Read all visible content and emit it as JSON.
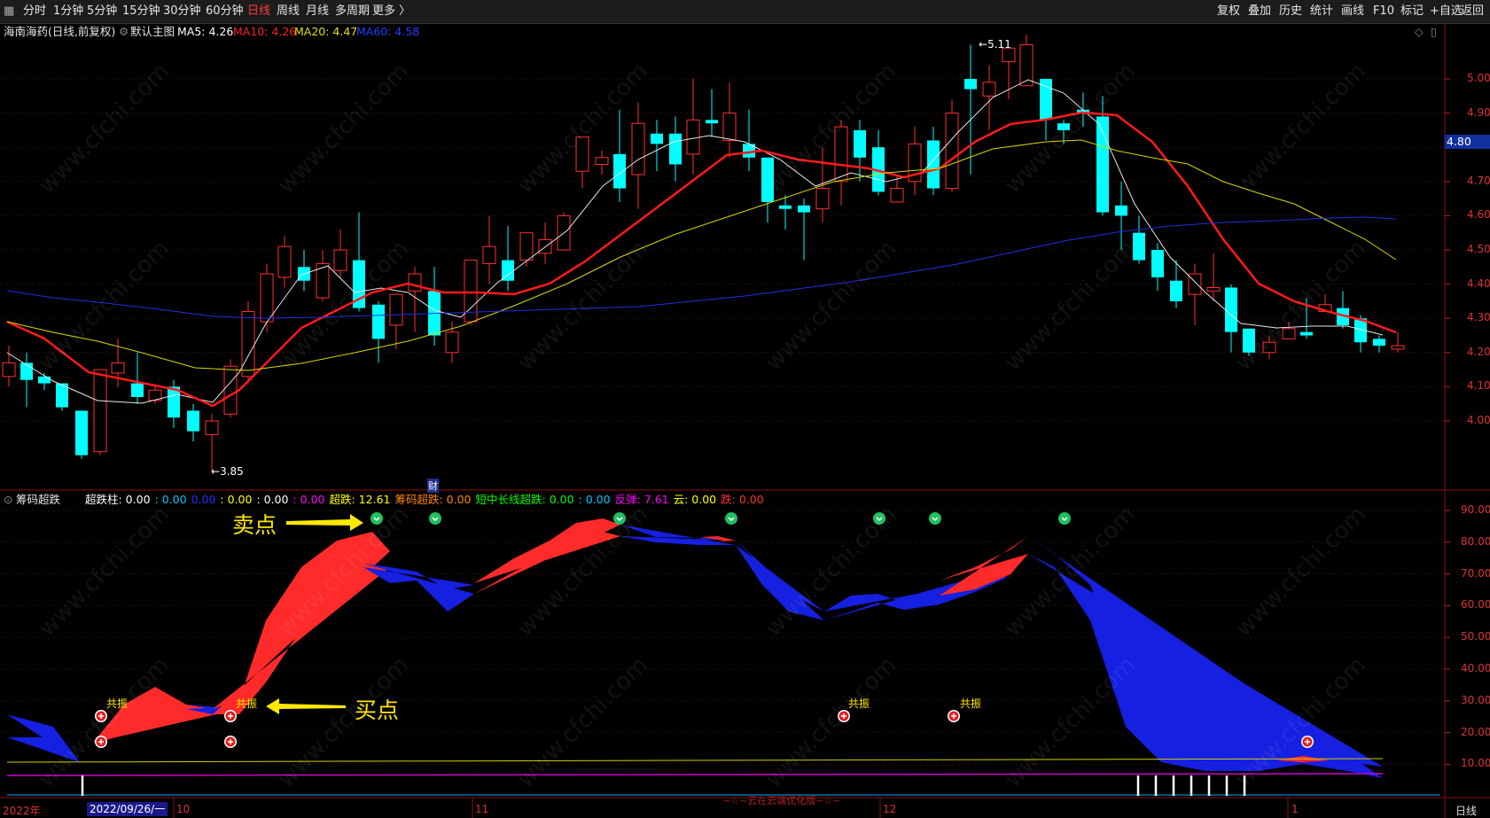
{
  "toolbar": {
    "menu_icon": "grid-icon",
    "periods": [
      "分时",
      "1分钟",
      "5分钟",
      "15分钟",
      "30分钟",
      "60分钟",
      "日线",
      "周线",
      "月线",
      "多周期",
      "更多 〉"
    ],
    "active_period": "日线",
    "right_buttons": [
      "复权",
      "叠加",
      "历史",
      "统计",
      "画线",
      "F10",
      "标记",
      "+自选",
      "返回"
    ]
  },
  "main_chart": {
    "title": "海南海药(日线,前复权)",
    "main_indicator": "默认主图",
    "ma5": {
      "label": "MA5: 4.26",
      "color": "#ffffff"
    },
    "ma10": {
      "label": "MA10: 4.26",
      "color": "#ff2020"
    },
    "ma20": {
      "label": "MA20: 4.47",
      "color": "#e0e000"
    },
    "ma60": {
      "label": "MA60: 4.58",
      "color": "#2040ff"
    },
    "y_ticks": [
      "5.00",
      "4.90",
      "4.80",
      "4.70",
      "4.60",
      "4.50",
      "4.40",
      "4.30",
      "4.20",
      "4.10",
      "4.00"
    ],
    "current_price": "4.80",
    "high_mark": "5.11",
    "low_mark": "3.85",
    "finance_mark": "财"
  },
  "indicator": {
    "name": "筹码超跌",
    "fields": [
      {
        "text": "超跌柱: 0.00",
        "color": "#ffffff"
      },
      {
        "text": ": 0.00",
        "color": "#00c8ff"
      },
      {
        "text": "0.00",
        "color": "#2a2aff"
      },
      {
        "text": ": 0.00",
        "color": "#ffff00"
      },
      {
        "text": ": 0.00",
        "color": "#ffffff"
      },
      {
        "text": ": 0.00",
        "color": "#ff00ff"
      },
      {
        "text": "超跌: 12.61",
        "color": "#ffff00"
      },
      {
        "text": "筹码超跌: 0.00",
        "color": "#ff8800"
      },
      {
        "text": "短中长线超跌: 0.00",
        "color": "#00ff00"
      },
      {
        "text": ": 0.00",
        "color": "#00c8ff"
      },
      {
        "text": "反弹: 7.61",
        "color": "#ff00ff"
      },
      {
        "text": "云: 0.00",
        "color": "#ffff00"
      },
      {
        "text": "跌: 0.00",
        "color": "#ff3030"
      }
    ],
    "y_ticks": [
      "90.00",
      "80.00",
      "70.00",
      "60.00",
      "50.00",
      "40.00",
      "30.00",
      "20.00",
      "10.00"
    ],
    "sell_label": "卖点",
    "buy_label": "买点",
    "resonance_label": "共振",
    "footer_text": "~☆~云在云端优化版~☆~"
  },
  "date_axis": {
    "year": "2022年",
    "selected": "2022/09/26/一",
    "months": [
      "10",
      "11",
      "12",
      "1"
    ],
    "period": "日线"
  },
  "watermark": "www.cfchi.com"
}
